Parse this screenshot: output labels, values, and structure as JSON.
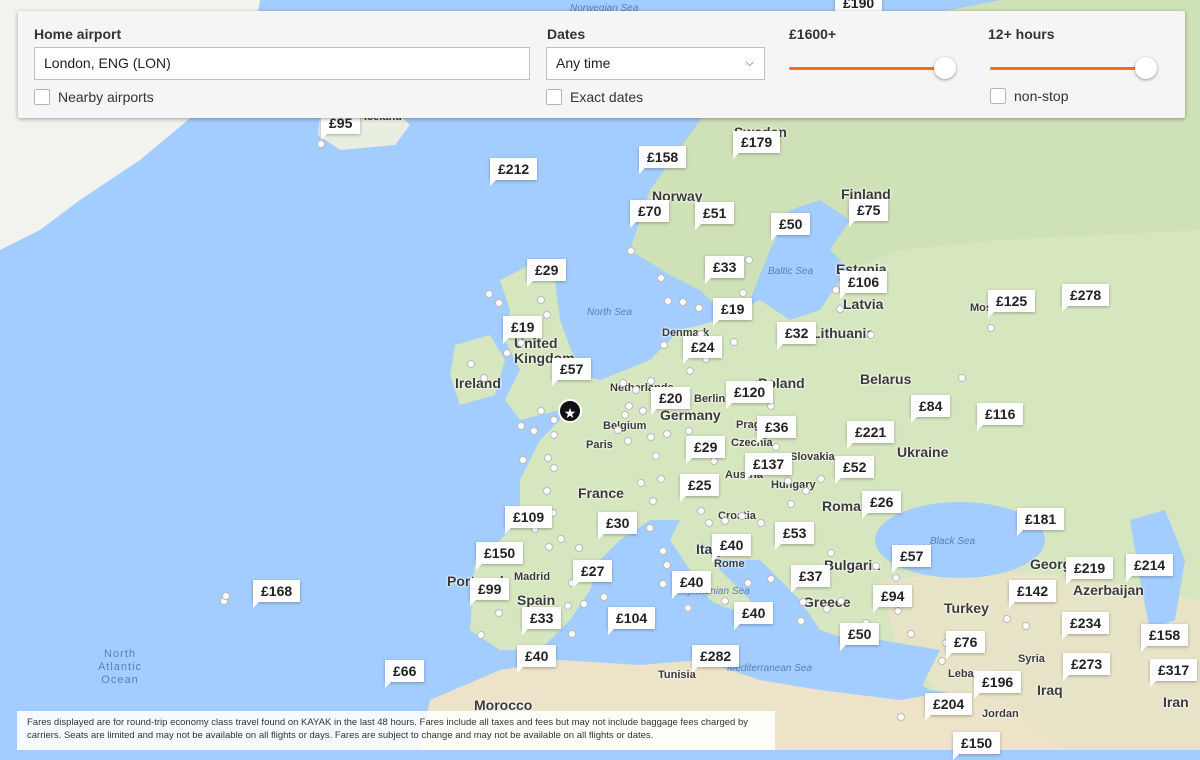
{
  "controls": {
    "home_airport_label": "Home airport",
    "home_airport_value": "London, ENG (LON)",
    "nearby_airports_label": "Nearby airports",
    "dates_label": "Dates",
    "dates_value": "Any time",
    "exact_dates_label": "Exact dates",
    "price_label": "£1600+",
    "price_level": 1.0,
    "duration_label": "12+ hours",
    "duration_level": 1.0,
    "nonstop_label": "non-stop"
  },
  "colors": {
    "accent": "#ff6b1a",
    "water": "#a3ccff",
    "land": "#d9e8c4"
  },
  "map": {
    "home_marker": {
      "icon": "star-icon",
      "label": "London"
    },
    "places": [
      "Norway",
      "Sweden",
      "Finland",
      "Estonia",
      "Latvia",
      "Lithuania",
      "United Kingdom",
      "Ireland",
      "Netherlands",
      "Belgium",
      "Germany",
      "Denmark",
      "Poland",
      "Belarus",
      "Ukraine",
      "Czechia",
      "Slovakia",
      "Hungary",
      "Austria",
      "France",
      "Croatia",
      "Italy",
      "Romania",
      "Bulgaria",
      "Greece",
      "Turkey",
      "Spain",
      "Portugal",
      "Madrid",
      "Rome",
      "Paris",
      "Berlin",
      "Prague",
      "Moscow",
      "Georgia",
      "Azerbaijan",
      "Syria",
      "Lebanon",
      "Iraq",
      "Iran",
      "Jordan",
      "Tunisia",
      "Morocco",
      "Iceland"
    ],
    "seas": [
      "Norwegian Sea",
      "North Sea",
      "Baltic Sea",
      "Black Sea",
      "Mediterranean Sea",
      "Tyrrhenian Sea",
      "North Atlantic Ocean"
    ],
    "prices": [
      "£190",
      "£95",
      "£212",
      "£158",
      "£179",
      "£70",
      "£51",
      "£50",
      "£75",
      "£29",
      "£33",
      "£106",
      "£19",
      "£125",
      "£278",
      "£19",
      "£32",
      "£24",
      "£57",
      "£20",
      "£120",
      "£84",
      "£116",
      "£36",
      "£221",
      "£29",
      "£137",
      "£52",
      "£25",
      "£26",
      "£109",
      "£30",
      "£181",
      "£53",
      "£40",
      "£150",
      "£57",
      "£27",
      "£37",
      "£219",
      "£214",
      "£99",
      "£40",
      "£142",
      "£168",
      "£94",
      "£33",
      "£104",
      "£40",
      "£234",
      "£158",
      "£50",
      "£76",
      "£40",
      "£282",
      "£273",
      "£317",
      "£66",
      "£196",
      "£204",
      "£150"
    ]
  },
  "footer": {
    "disclaimer": "Fares displayed are for round-trip economy class travel found on KAYAK in the last 48 hours. Fares include all taxes and fees but may not include baggage fees charged by carriers. Seats are limited and may not be available on all flights or days. Fares are subject to change and may not be available on all flights or dates."
  }
}
